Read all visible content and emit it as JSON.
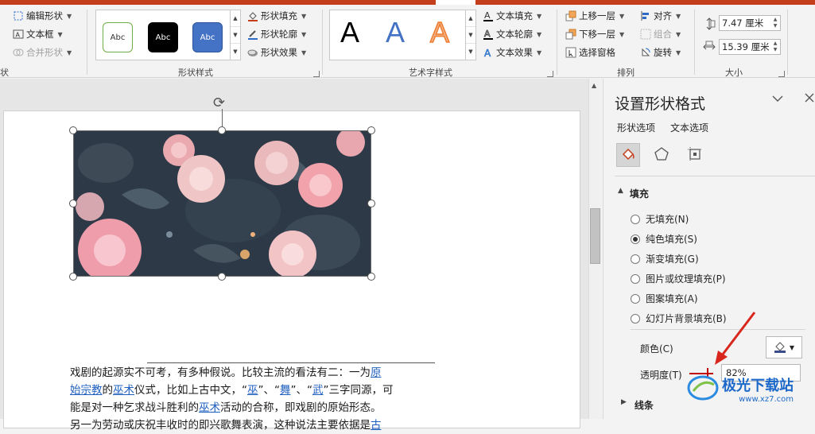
{
  "ribbon": {
    "insert_shapes": {
      "edit_shape": "编辑形状",
      "text_box": "文本框",
      "merge_shapes": "合并形状",
      "group_label_partial": "状"
    },
    "shape_styles": {
      "label": "形状样式",
      "swatch_text": "Abc",
      "fill": "形状填充",
      "outline": "形状轮廓",
      "effects": "形状效果",
      "swatch_colors": [
        "#ffffff",
        "#000000",
        "#4472c4"
      ]
    },
    "wordart_styles": {
      "label": "艺术字样式",
      "letter": "A",
      "text_fill": "文本填充",
      "text_outline": "文本轮廓",
      "text_effects": "文本效果"
    },
    "arrange": {
      "label": "排列",
      "bring_forward": "上移一层",
      "send_backward": "下移一层",
      "selection_pane": "选择窗格",
      "align": "对齐",
      "group": "组合",
      "rotate": "旋转"
    },
    "size": {
      "label": "大小",
      "height": "7.47 厘米",
      "width": "15.39 厘米"
    }
  },
  "slide": {
    "line1": [
      "戏剧的起源实不可考，有多种假说。比较主流的看法有二：一为",
      "原"
    ],
    "line2": [
      "始宗教",
      "的",
      "巫术",
      "仪式，比如上古中文，“",
      "巫",
      "”、“",
      "舞",
      "”、“",
      "武",
      "”三字同源，可"
    ],
    "line3": [
      "能是对一种乞求战斗胜利的",
      "巫术",
      "活动的合称，即戏剧的原始形态。"
    ],
    "line4": [
      "另一为劳动或庆祝丰收时的即兴歌舞表演，这种说法主要依据是",
      "古"
    ]
  },
  "pane": {
    "title": "设置形状格式",
    "tab_shape": "形状选项",
    "tab_text": "文本选项",
    "fill_section": "填充",
    "fill_options": [
      {
        "label": "无填充(N)",
        "selected": false
      },
      {
        "label": "纯色填充(S)",
        "selected": true
      },
      {
        "label": "渐变填充(G)",
        "selected": false
      },
      {
        "label": "图片或纹理填充(P)",
        "selected": false
      },
      {
        "label": "图案填充(A)",
        "selected": false
      },
      {
        "label": "幻灯片背景填充(B)",
        "selected": false
      }
    ],
    "color_label": "颜色(C)",
    "transparency_label": "透明度(T)",
    "transparency_value": "82%",
    "line_section": "线条"
  },
  "watermark": {
    "main": "极光下载站",
    "sub": "www.xz7.com"
  },
  "colors": {
    "accent_red": "#c43e1c",
    "link_blue": "#1f5fbf",
    "annotation_red": "#d9261c"
  }
}
